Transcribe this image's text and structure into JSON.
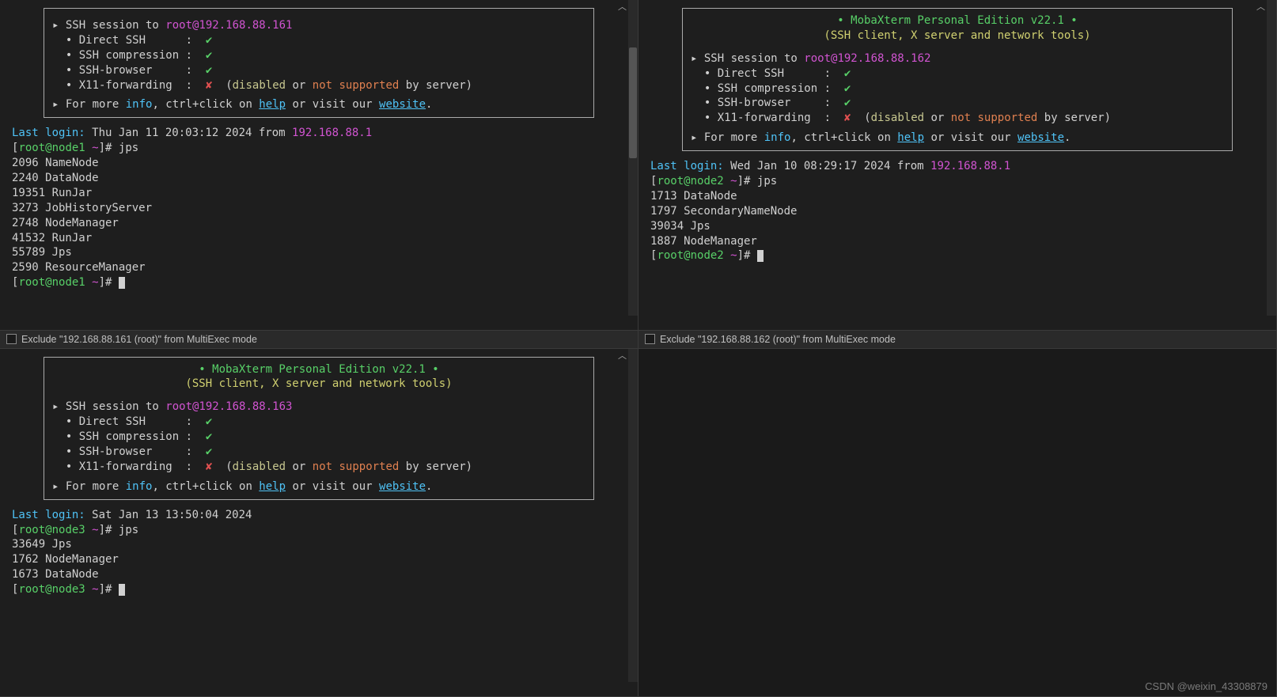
{
  "banner": {
    "title": "• MobaXterm Personal Edition v22.1 •",
    "subtitle": "(SSH client, X server and network tools)",
    "item_direct": "Direct SSH",
    "item_comp": "SSH compression",
    "item_browser": "SSH-browser",
    "item_x11": "X11-forwarding",
    "x11_disabled_pre": "(",
    "x11_disabled_1": "disabled",
    "x11_or": " or ",
    "x11_disabled_2": "not supported",
    "x11_by": " by server)",
    "more_pre": "For more ",
    "more_info": "info",
    "more_mid": ", ctrl+click on ",
    "more_help": "help",
    "more_mid2": " or visit our ",
    "more_site": "website",
    "more_end": "."
  },
  "pane1": {
    "session_pre": "SSH session to ",
    "session_target": "root@192.168.88.161",
    "last_login_label": "Last login:",
    "last_login_rest": " Thu Jan 11 20:03:12 2024 from ",
    "last_login_ip": "192.168.88.1",
    "prompt_host": "root@node1",
    "prompt_path": "~",
    "cmd": "jps",
    "out": [
      "2096 NameNode",
      "2240 DataNode",
      "19351 RunJar",
      "3273 JobHistoryServer",
      "2748 NodeManager",
      "41532 RunJar",
      "55789 Jps",
      "2590 ResourceManager"
    ],
    "exclude": "Exclude \"192.168.88.161 (root)\" from MultiExec mode"
  },
  "pane2": {
    "session_pre": "SSH session to ",
    "session_target": "root@192.168.88.162",
    "last_login_label": "Last login:",
    "last_login_rest": " Wed Jan 10 08:29:17 2024 from ",
    "last_login_ip": "192.168.88.1",
    "prompt_host": "root@node2",
    "prompt_path": "~",
    "cmd": "jps",
    "out": [
      "1713 DataNode",
      "1797 SecondaryNameNode",
      "39034 Jps",
      "1887 NodeManager"
    ],
    "exclude": "Exclude \"192.168.88.162 (root)\" from MultiExec mode"
  },
  "pane3": {
    "session_pre": "SSH session to ",
    "session_target": "root@192.168.88.163",
    "last_login_label": "Last login:",
    "last_login_rest": " Sat Jan 13 13:50:04 2024",
    "last_login_ip": "",
    "prompt_host": "root@node3",
    "prompt_path": "~",
    "cmd": "jps",
    "out": [
      "33649 Jps",
      "1762 NodeManager",
      "1673 DataNode"
    ]
  },
  "watermark": "CSDN @weixin_43308879"
}
